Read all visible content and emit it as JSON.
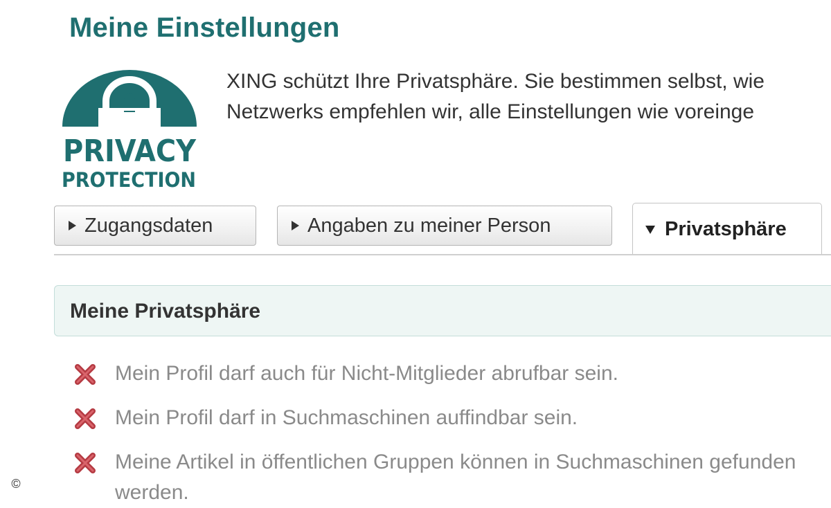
{
  "page": {
    "title": "Meine Einstellungen"
  },
  "logo": {
    "line1": "PRIVACY",
    "line2": "PROTECTION",
    "icon": "padlock-icon",
    "color": "#1f6f70"
  },
  "intro": {
    "line1": "XING schützt Ihre Privatsphäre. Sie bestimmen selbst, wie",
    "line2": "Netzwerks empfehlen wir, alle Einstellungen wie voreinge"
  },
  "tabs": [
    {
      "label": "Zugangsdaten",
      "active": false
    },
    {
      "label": "Angaben zu meiner Person",
      "active": false
    },
    {
      "label": "Privatsphäre",
      "active": true
    }
  ],
  "section": {
    "title": "Meine Privatsphäre"
  },
  "settings": [
    {
      "label": "Mein Profil darf auch für Nicht-Mitglieder abrufbar sein.",
      "enabled": false,
      "icon": "x-mark-icon"
    },
    {
      "label": "Mein Profil darf in Suchmaschinen auffindbar sein.",
      "enabled": false,
      "icon": "x-mark-icon"
    },
    {
      "label": "Meine Artikel in öffentlichen Gruppen können in Suchmaschinen gefunden werden.",
      "enabled": false,
      "icon": "x-mark-icon"
    }
  ],
  "copyright_symbol": "©",
  "colors": {
    "accent": "#1f6f70",
    "section_bg": "#eef6f4",
    "x_mark": "#b53b43"
  }
}
